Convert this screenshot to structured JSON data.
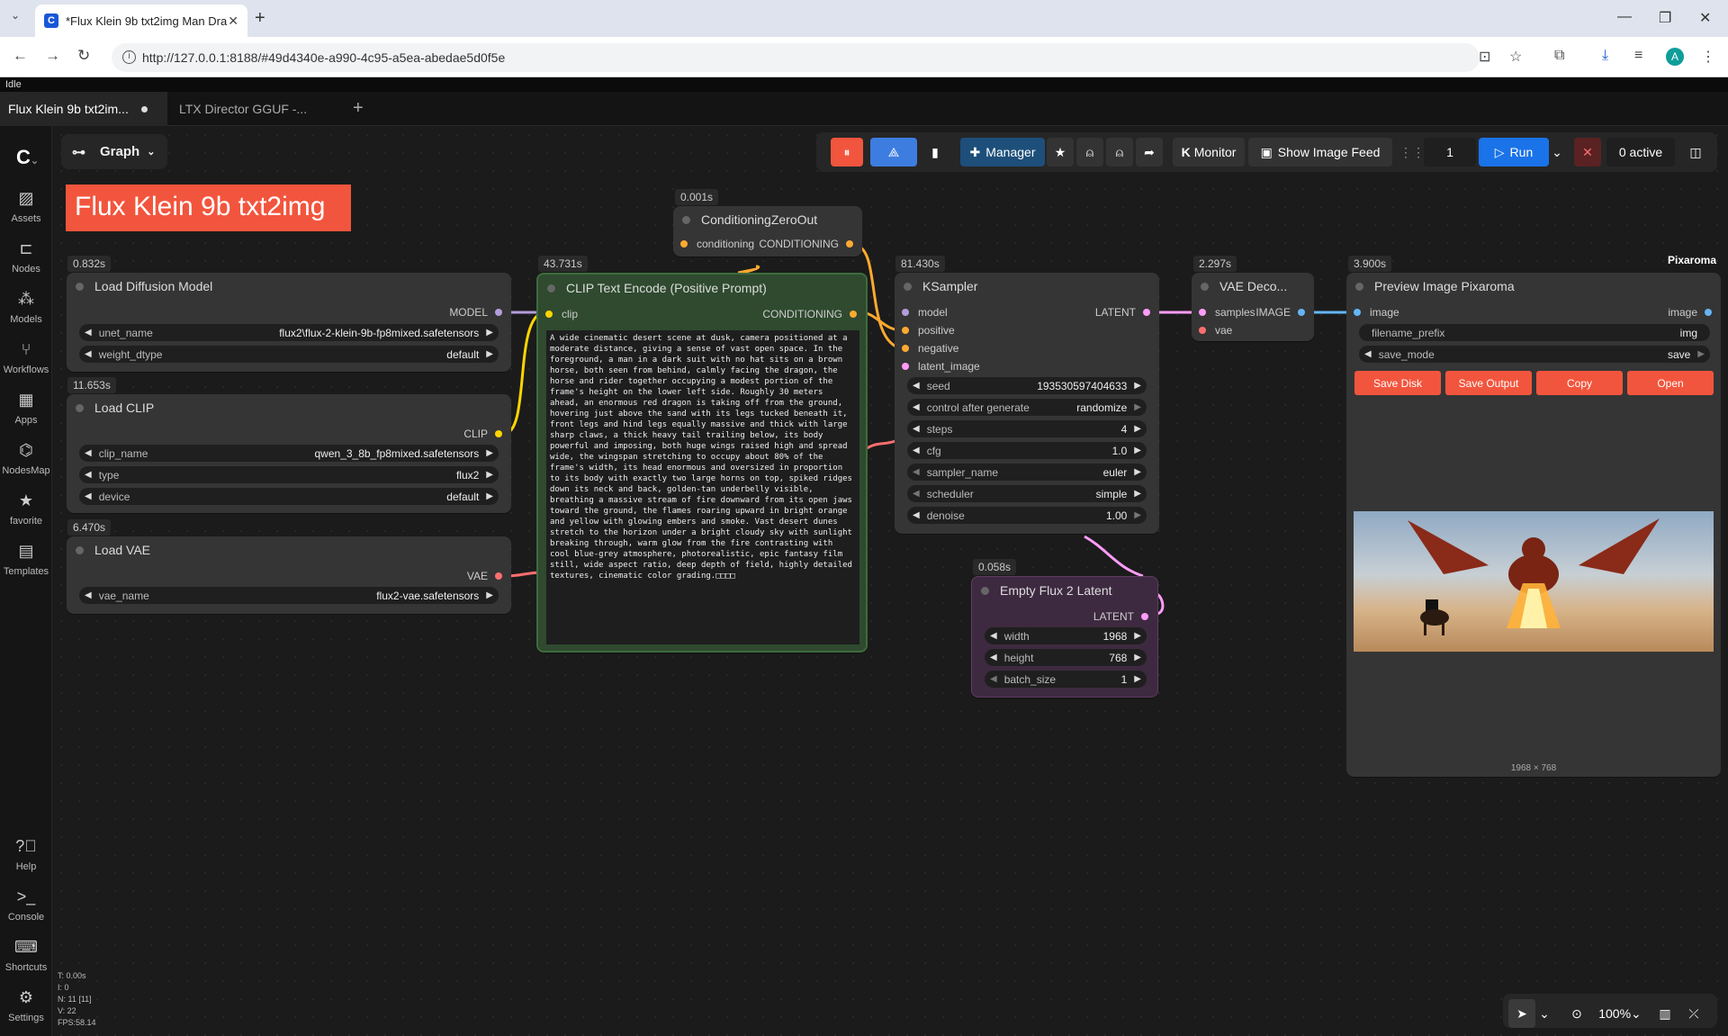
{
  "browser": {
    "tab_title": "*Flux Klein 9b txt2img Man Dra",
    "favicon_letter": "C",
    "url": "http://127.0.0.1:8188/#49d4340e-a990-4c95-a5ea-abedae5d0f5e",
    "profile_initial": "A"
  },
  "app": {
    "status": "Idle",
    "tabs": [
      {
        "label": "Flux Klein 9b txt2im...",
        "active": true
      },
      {
        "label": "LTX Director GGUF -...",
        "active": false
      }
    ],
    "graph_label": "Graph",
    "title_banner": "Flux Klein 9b txt2img",
    "sidebar": [
      {
        "label": "Assets",
        "icon": "assets-icon"
      },
      {
        "label": "Nodes",
        "icon": "nodes-icon"
      },
      {
        "label": "Models",
        "icon": "models-icon"
      },
      {
        "label": "Workflows",
        "icon": "workflows-icon"
      },
      {
        "label": "Apps",
        "icon": "apps-icon"
      },
      {
        "label": "NodesMap",
        "icon": "nodesmap-icon"
      },
      {
        "label": "favorite",
        "icon": "star-icon"
      },
      {
        "label": "Templates",
        "icon": "templates-icon"
      },
      {
        "label": "Help",
        "icon": "help-icon"
      },
      {
        "label": "Console",
        "icon": "console-icon"
      },
      {
        "label": "Shortcuts",
        "icon": "keyboard-icon"
      },
      {
        "label": "Settings",
        "icon": "gear-icon"
      }
    ],
    "toolbar": {
      "manager_label": "Manager",
      "monitor_label": "Monitor",
      "monitor_prefix": "K",
      "image_feed_label": "Show Image Feed",
      "batch_count": "1",
      "run_label": "Run",
      "active_label": "0 active"
    },
    "stats": {
      "t": "T: 0.00s",
      "i": "I: 0",
      "n": "N: 11 [11]",
      "v": "V: 22",
      "fps": "FPS:58.14"
    },
    "zoom": "100%"
  },
  "nodes": {
    "load_diffusion": {
      "timing": "0.832s",
      "title": "Load Diffusion Model",
      "output": "MODEL",
      "widgets": [
        {
          "label": "unet_name",
          "value": "flux2\\flux-2-klein-9b-fp8mixed.safetensors"
        },
        {
          "label": "weight_dtype",
          "value": "default"
        }
      ]
    },
    "load_clip": {
      "timing": "11.653s",
      "title": "Load CLIP",
      "output": "CLIP",
      "widgets": [
        {
          "label": "clip_name",
          "value": "qwen_3_8b_fp8mixed.safetensors"
        },
        {
          "label": "type",
          "value": "flux2"
        },
        {
          "label": "device",
          "value": "default"
        }
      ]
    },
    "load_vae": {
      "timing": "6.470s",
      "title": "Load VAE",
      "output": "VAE",
      "widgets": [
        {
          "label": "vae_name",
          "value": "flux2-vae.safetensors"
        }
      ]
    },
    "clip_text": {
      "timing": "43.731s",
      "title": "CLIP Text Encode (Positive Prompt)",
      "input": "clip",
      "output": "CONDITIONING",
      "prompt": "A wide cinematic desert scene at dusk, camera positioned at a moderate distance, giving a sense of vast open space. In the foreground, a man in a dark suit with no hat sits on a brown horse, both seen from behind, calmly facing the dragon, the horse and rider together occupying a modest portion of the frame's height on the lower left side. Roughly 30 meters ahead, an enormous red dragon is taking off from the ground, hovering just above the sand with its legs tucked beneath it, front legs and hind legs equally massive and thick with large sharp claws, a thick heavy tail trailing below, its body powerful and imposing, both huge wings raised high and spread wide, the wingspan stretching to occupy about 80% of the frame's width, its head enormous and oversized in proportion to its body with exactly two large horns on top, spiked ridges down its neck and back, golden-tan underbelly visible, breathing a massive stream of fire downward from its open jaws toward the ground, the flames roaring upward in bright orange and yellow with glowing embers and smoke. Vast desert dunes stretch to the horizon under a bright cloudy sky with sunlight breaking through, warm glow from the fire contrasting with cool blue-grey atmosphere, photorealistic, epic fantasy film still, wide aspect ratio, deep depth of field, highly detailed textures, cinematic color grading.□□□□"
    },
    "cond_zero": {
      "timing": "0.001s",
      "title": "ConditioningZeroOut",
      "input": "conditioning",
      "output": "CONDITIONING"
    },
    "ksampler": {
      "timing": "81.430s",
      "title": "KSampler",
      "output": "LATENT",
      "inputs": [
        "model",
        "positive",
        "negative",
        "latent_image"
      ],
      "widgets": [
        {
          "label": "seed",
          "value": "193530597404633"
        },
        {
          "label": "control after generate",
          "value": "randomize"
        },
        {
          "label": "steps",
          "value": "4"
        },
        {
          "label": "cfg",
          "value": "1.0"
        },
        {
          "label": "sampler_name",
          "value": "euler"
        },
        {
          "label": "scheduler",
          "value": "simple"
        },
        {
          "label": "denoise",
          "value": "1.00"
        }
      ]
    },
    "vae_decode": {
      "timing": "2.297s",
      "title": "VAE Deco...",
      "output": "IMAGE",
      "inputs": [
        "samples",
        "vae"
      ]
    },
    "preview": {
      "timing": "3.900s",
      "title": "Preview Image Pixaroma",
      "badge": "Pixaroma",
      "input": "image",
      "output": "image",
      "widgets": [
        {
          "label": "filename_prefix",
          "value": "img"
        },
        {
          "label": "save_mode",
          "value": "save"
        }
      ],
      "buttons": [
        "Save Disk",
        "Save Output",
        "Copy",
        "Open"
      ],
      "dimensions": "1968 × 768"
    },
    "empty_latent": {
      "timing": "0.058s",
      "title": "Empty Flux 2 Latent",
      "output": "LATENT",
      "widgets": [
        {
          "label": "width",
          "value": "1968"
        },
        {
          "label": "height",
          "value": "768"
        },
        {
          "label": "batch_size",
          "value": "1"
        }
      ]
    }
  },
  "colors": {
    "accent": "#f2553d",
    "run_blue": "#1a73e8",
    "model_port": "#b39ddb",
    "clip_port": "#ffd500",
    "vae_port": "#ff6e6e",
    "cond_port": "#ffa931",
    "latent_port": "#ff9cf9",
    "image_port": "#64b5f6"
  }
}
